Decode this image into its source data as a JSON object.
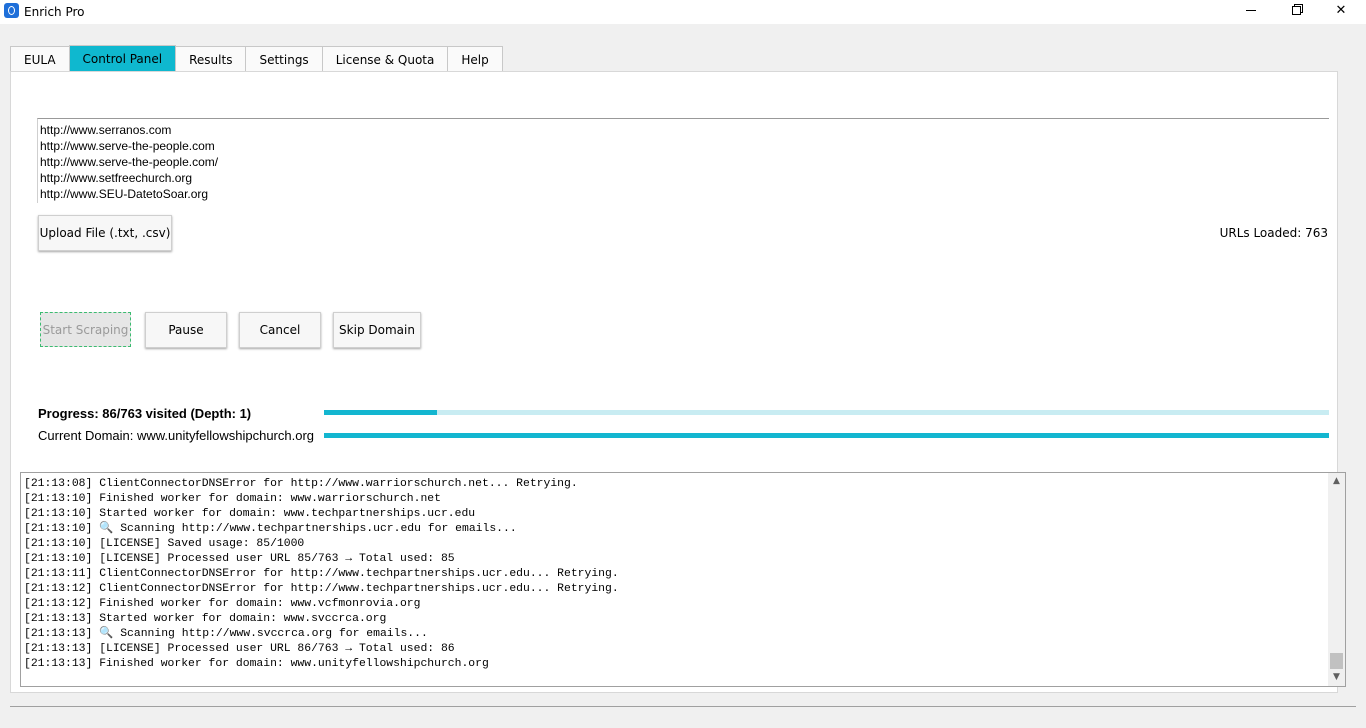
{
  "window": {
    "title": "Enrich Pro",
    "icon": "enrich-pro-logo-icon",
    "accent": "#0fb8cf"
  },
  "tabs": [
    {
      "label": "EULA",
      "active": false
    },
    {
      "label": "Control Panel",
      "active": true
    },
    {
      "label": "Results",
      "active": false
    },
    {
      "label": "Settings",
      "active": false
    },
    {
      "label": "License & Quota",
      "active": false
    },
    {
      "label": "Help",
      "active": false
    }
  ],
  "url_list": [
    "http://www.serranos.com",
    "http://www.serve-the-people.com",
    "http://www.serve-the-people.com/",
    "http://www.setfreechurch.org",
    "http://www.SEU-DatetoSoar.org"
  ],
  "upload": {
    "label": "Upload File (.txt, .csv)",
    "urls_loaded": "URLs Loaded: 763"
  },
  "controls": {
    "start": "Start Scraping",
    "pause": "Pause",
    "cancel": "Cancel",
    "skip": "Skip Domain"
  },
  "progress": {
    "label": "Progress: 86/763 visited (Depth: 1)",
    "fraction": 0.1127,
    "current_domain": "Current Domain: www.unityfellowshipchurch.org"
  },
  "log": [
    "[21:13:08] ClientConnectorDNSError for http://www.warriorschurch.net... Retrying.",
    "[21:13:10] Finished worker for domain: www.warriorschurch.net",
    "[21:13:10] Started worker for domain: www.techpartnerships.ucr.edu",
    "[21:13:10] 🔍 Scanning http://www.techpartnerships.ucr.edu for emails...",
    "[21:13:10] [LICENSE] Saved usage: 85/1000",
    "[21:13:10] [LICENSE] Processed user URL 85/763 → Total used: 85",
    "[21:13:11] ClientConnectorDNSError for http://www.techpartnerships.ucr.edu... Retrying.",
    "[21:13:12] ClientConnectorDNSError for http://www.techpartnerships.ucr.edu... Retrying.",
    "[21:13:12] Finished worker for domain: www.vcfmonrovia.org",
    "[21:13:13] Started worker for domain: www.svccrca.org",
    "[21:13:13] 🔍 Scanning http://www.svccrca.org for emails...",
    "[21:13:13] [LICENSE] Processed user URL 86/763 → Total used: 86",
    "[21:13:13] Finished worker for domain: www.unityfellowshipchurch.org"
  ]
}
